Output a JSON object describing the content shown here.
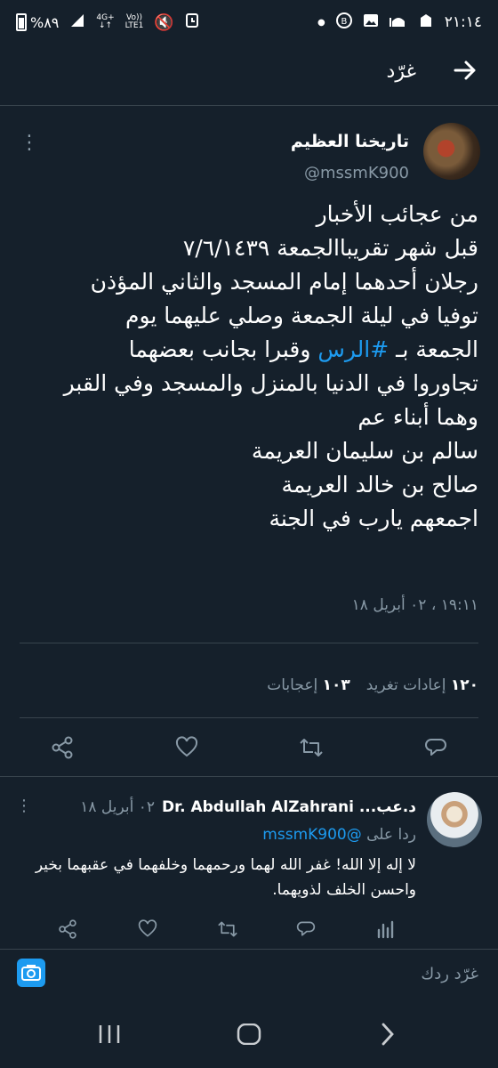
{
  "status_bar": {
    "time": "٢١:١٤",
    "battery": "%٨٩",
    "network_top": "4G+",
    "network_arrows": "↓↑",
    "volte_top": "Vo))",
    "volte_bottom": "LTE1"
  },
  "header": {
    "title": "غرّد",
    "back_icon": "arrow-right-icon"
  },
  "tweet": {
    "author_name": "تاريخنا العظيم",
    "author_handle": "@mssmK900",
    "lines": {
      "l1": "من عجائب الأخبار",
      "l2": "قبل شهر تقريباالجمعة ٧/٦/١٤٣٩",
      "l3": "رجلان أحدهما إمام المسجد والثاني المؤذن",
      "l4": "توفيا في ليلة الجمعة وصلي عليهما يوم",
      "l5_prefix": "الجمعة بـ ",
      "l5_hashtag": "#الرس",
      "l5_suffix": " وقبرا بجانب بعضهما",
      "l6": "تجاوروا في الدنيا بالمنزل والمسجد وفي القبر",
      "l7": "وهما أبناء عم",
      "l8": "سالم بن سليمان العريمة",
      "l9": "صالح بن خالد العريمة",
      "l10": "اجمعهم يارب في الجنة"
    },
    "timestamp": "١٩:١١ ، ٠٢ أبريل ١٨",
    "retweet_count": "١٢٠",
    "retweet_label": "إعادات تغريد",
    "like_count": "١٠٣",
    "like_label": "إعجابات"
  },
  "reply": {
    "name": "د.عب... Dr. Abdullah AlZahrani",
    "date": "٠٢ أبريل ١٨",
    "reply_prefix": "ردا على ",
    "reply_handle": "@mssmK900",
    "text": "لا إله إلا الله! غفر الله لهما ورحمهما وخلفهما في عقبهما بخير واحسن الخلف لذويهما."
  },
  "composer": {
    "placeholder": "غرّد ردك"
  },
  "colors": {
    "background": "#15202b",
    "accent": "#1d9bf0",
    "muted": "#8899a6",
    "divider": "#38444d"
  }
}
